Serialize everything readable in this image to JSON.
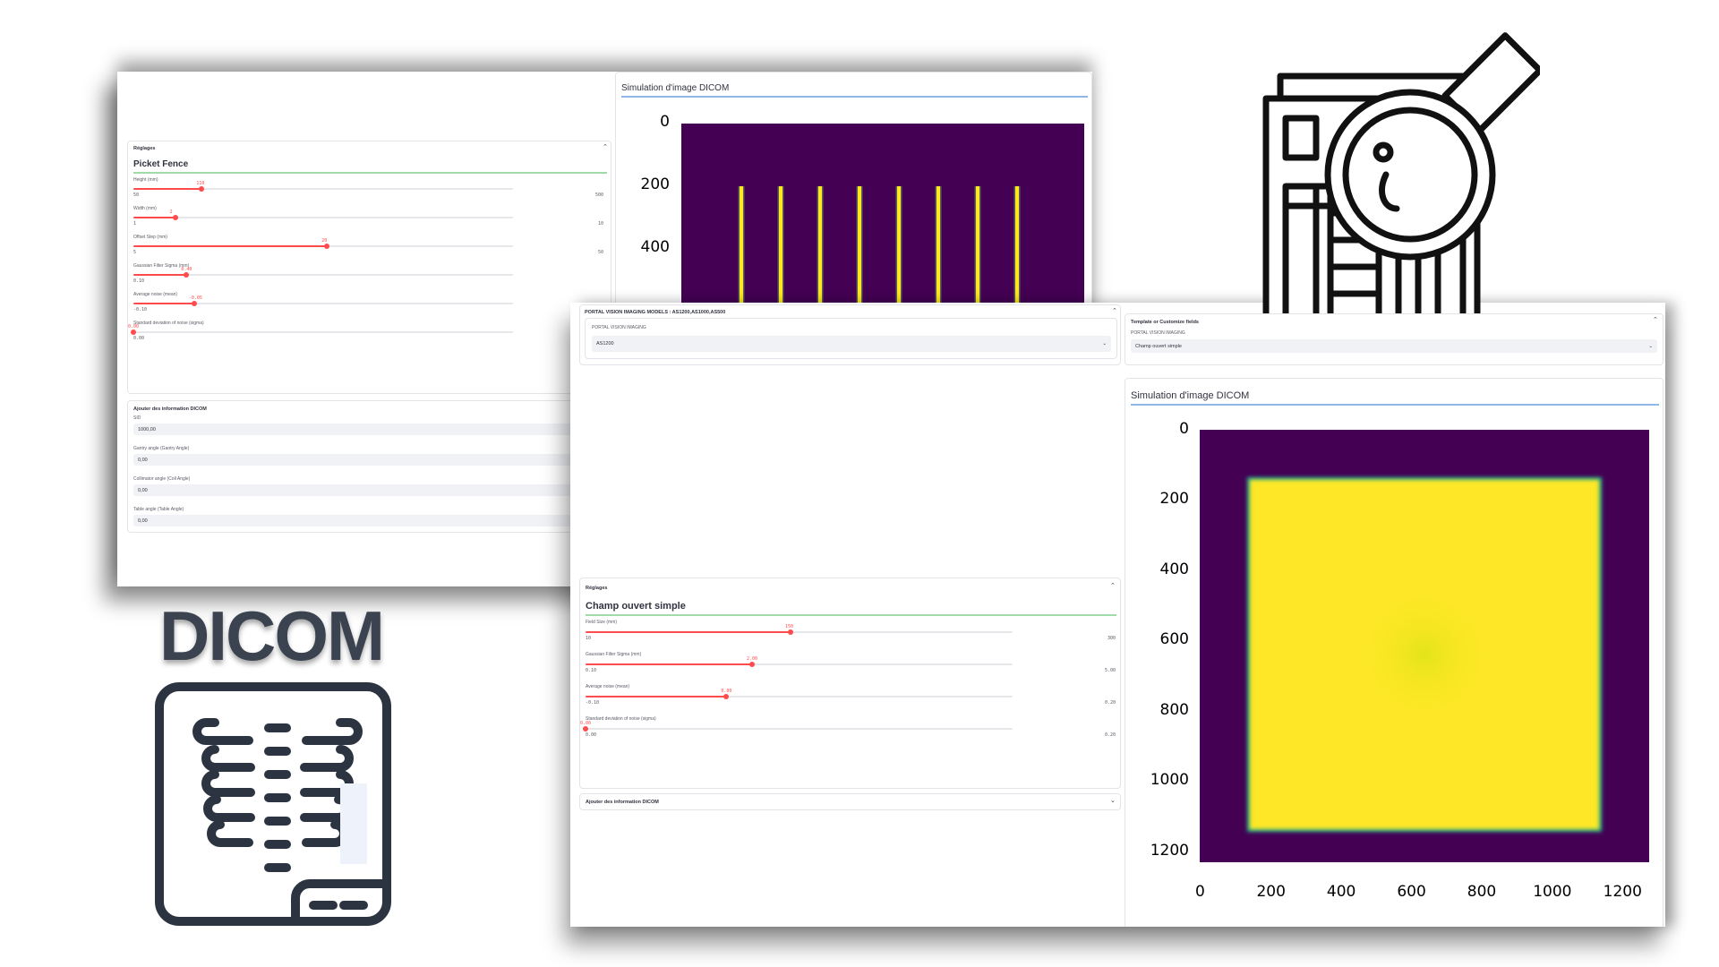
{
  "screen1": {
    "expander_label": "Réglages",
    "test_title": "Picket Fence",
    "sliders": [
      {
        "label": "Height (mm)",
        "value": "110",
        "min": "50",
        "max": "500",
        "fraction": 0.18
      },
      {
        "label": "Width (mm)",
        "value": "2",
        "min": "1",
        "max": "10",
        "fraction": 0.11
      },
      {
        "label": "Offset Step (mm)",
        "value": "20",
        "min": "5",
        "max": "50",
        "fraction": 0.51
      },
      {
        "label": "Gaussian Filter Sigma (mm)",
        "value": "0.40",
        "min": "0.10",
        "max": "",
        "fraction": 0.14
      },
      {
        "label": "Average noise (mean)",
        "value": "-0.05",
        "min": "-0.10",
        "max": "",
        "fraction": 0.16
      },
      {
        "label": "Standard deviation of noise (sigma)",
        "value": "0.00",
        "min": "0.00",
        "max": "",
        "fraction": 0.0
      }
    ],
    "dicom_section": {
      "label": "Ajouter des information DICOM",
      "fields": [
        {
          "label": "SID",
          "value": "1000,00"
        },
        {
          "label": "Gantry angle (Gantry Angle)",
          "value": "0,00"
        },
        {
          "label": "Collimator angle (Coll Angle)",
          "value": "0,00"
        },
        {
          "label": "Table angle (Table Angle)",
          "value": "0,00"
        }
      ]
    },
    "sim_title": "Simulation d'image DICOM",
    "chart_data": {
      "type": "heatmap",
      "title": "",
      "y_ticks": [
        "0",
        "200",
        "400"
      ],
      "colormap": "viridis",
      "description": "Picket fence: 8 vertical bright lines on dark background",
      "line_count": 8
    }
  },
  "screen2": {
    "models_expander": "PORTAL VISION IMAGING MODELS : AS1200,AS1000,AS500",
    "model_label": "PORTAL VISION IMAGING",
    "model_value": "AS1200",
    "template_expander": "Template or Customize fields",
    "template_label": "PORTAL VISION IMAGING",
    "template_value": "Champ ouvert simple",
    "expander_label": "Réglages",
    "test_title": "Champ ouvert simple",
    "sliders": [
      {
        "label": "Field Size (mm)",
        "value": "150",
        "min": "10",
        "max": "300",
        "fraction": 0.48
      },
      {
        "label": "Gaussian Filter Sigma (mm)",
        "value": "2.00",
        "min": "0.10",
        "max": "5.00",
        "fraction": 0.39
      },
      {
        "label": "Average noise (mean)",
        "value": "0.00",
        "min": "-0.10",
        "max": "0.20",
        "fraction": 0.33
      },
      {
        "label": "Standard deviation of noise (sigma)",
        "value": "0.00",
        "min": "0.00",
        "max": "0.20",
        "fraction": 0.0
      }
    ],
    "dicom_section_label": "Ajouter des information DICOM",
    "sim_title": "Simulation d'image DICOM",
    "chart_data": {
      "type": "heatmap",
      "title": "",
      "x_ticks": [
        "0",
        "200",
        "400",
        "600",
        "800",
        "1000",
        "1200"
      ],
      "y_ticks": [
        "0",
        "200",
        "400",
        "600",
        "800",
        "1000",
        "1200"
      ],
      "xlim": [
        0,
        1280
      ],
      "ylim": [
        1280,
        0
      ],
      "colormap": "viridis",
      "field_extent": [
        140,
        1140
      ]
    }
  },
  "logo_text": "DICOM",
  "colors": {
    "accent": "#ff4b4b",
    "dark": "#440154",
    "bright": "#fde725",
    "icon": "#2b3440"
  },
  "icons": [
    "document-search-icon",
    "xray-film-icon"
  ]
}
